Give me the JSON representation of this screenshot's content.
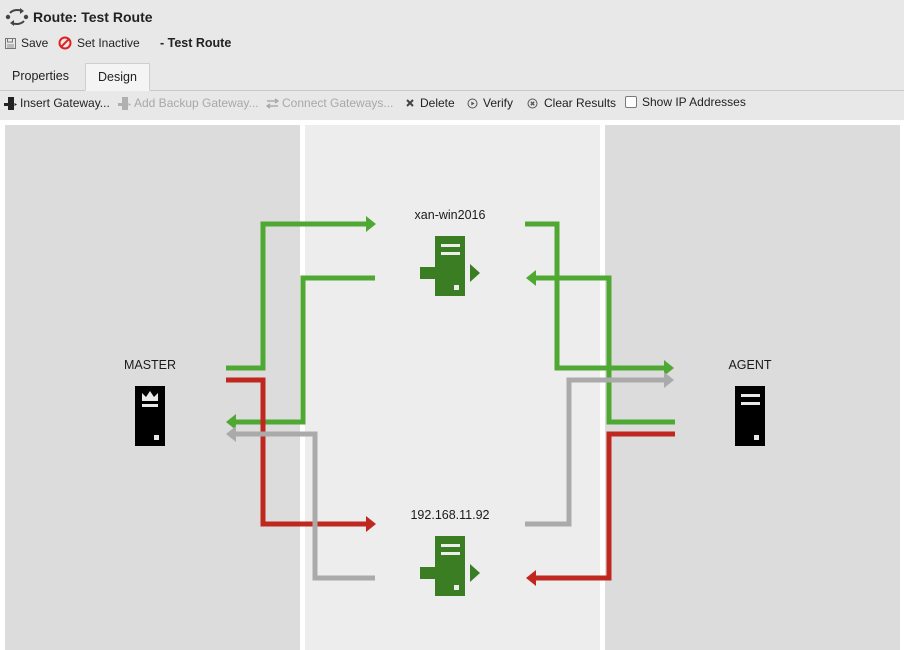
{
  "window": {
    "title": "Route: Test Route",
    "icon": "route-cycle-icon"
  },
  "actions": {
    "save_label": "Save",
    "save_icon": "floppy-disk-icon",
    "set_inactive_label": "Set Inactive",
    "set_inactive_icon": "prohibited-icon",
    "subtitle": "- Test Route"
  },
  "tabs": [
    {
      "label": "Properties",
      "active": false
    },
    {
      "label": "Design",
      "active": true
    }
  ],
  "toolbar": {
    "insert_gateway": {
      "label": "Insert Gateway...",
      "enabled": true,
      "icon": "gateway-server-icon"
    },
    "add_backup_gateway": {
      "label": "Add Backup Gateway...",
      "enabled": false,
      "icon": "gateway-server-icon"
    },
    "connect_gateways": {
      "label": "Connect Gateways...",
      "enabled": false,
      "icon": "swap-arrows-icon"
    },
    "delete": {
      "label": "Delete",
      "enabled": true,
      "icon": "x-mark-icon"
    },
    "verify": {
      "label": "Verify",
      "enabled": true,
      "icon": "play-circle-icon"
    },
    "clear_results": {
      "label": "Clear Results",
      "enabled": true,
      "icon": "x-circle-icon"
    },
    "show_ip": {
      "label": "Show IP Addresses",
      "checked": false
    }
  },
  "diagram": {
    "colors": {
      "success": "#4ea832",
      "failure": "#c0271e",
      "unknown": "#aaaaaa",
      "gateway": "#3a7d22",
      "endpoint": "#000000",
      "column_side": "#dcdcdc",
      "column_middle": "#ededed"
    },
    "master": {
      "label": "MASTER",
      "icon": "master-server-crown-icon"
    },
    "agent": {
      "label": "AGENT",
      "icon": "agent-server-icon"
    },
    "gateways": [
      {
        "label": "xan-win2016",
        "icon": "gateway-server-icon",
        "status": "success"
      },
      {
        "label": "192.168.11.92",
        "icon": "gateway-server-icon",
        "status": "success"
      }
    ],
    "connections": [
      {
        "name": "master-to-gw1",
        "from": "MASTER",
        "to": "xan-win2016",
        "status": "success"
      },
      {
        "name": "gw1-to-master",
        "from": "xan-win2016",
        "to": "MASTER",
        "status": "success"
      },
      {
        "name": "gw1-to-agent",
        "from": "xan-win2016",
        "to": "AGENT",
        "status": "success"
      },
      {
        "name": "agent-to-gw1",
        "from": "AGENT",
        "to": "xan-win2016",
        "status": "success"
      },
      {
        "name": "master-to-gw2",
        "from": "MASTER",
        "to": "192.168.11.92",
        "status": "failure"
      },
      {
        "name": "gw2-to-master",
        "from": "192.168.11.92",
        "to": "MASTER",
        "status": "unknown"
      },
      {
        "name": "gw2-to-agent",
        "from": "192.168.11.92",
        "to": "AGENT",
        "status": "unknown"
      },
      {
        "name": "agent-to-gw2",
        "from": "AGENT",
        "to": "192.168.11.92",
        "status": "failure"
      }
    ]
  }
}
